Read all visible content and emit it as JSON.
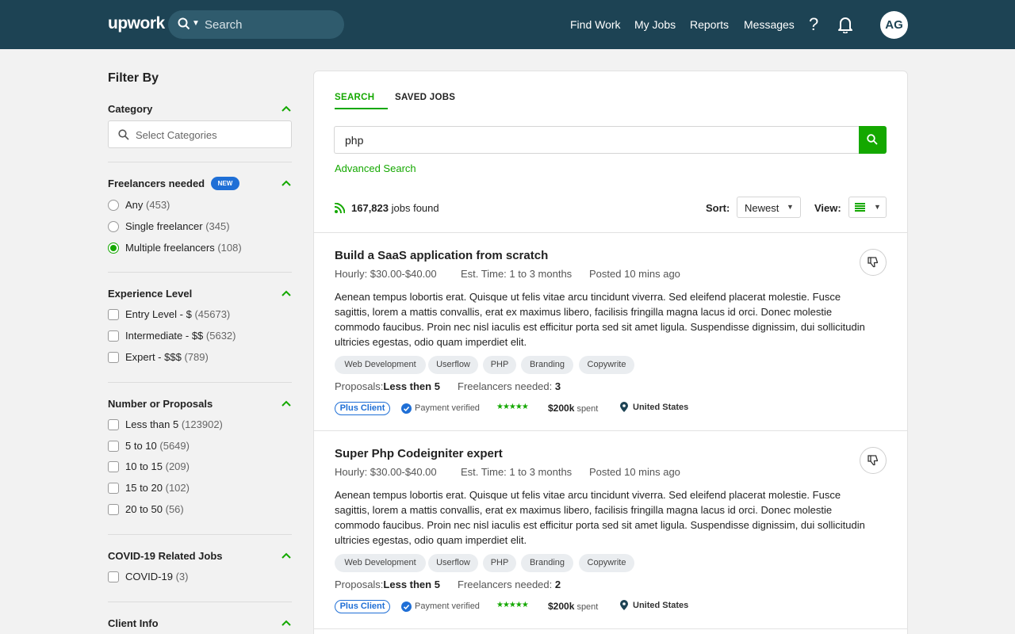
{
  "topnav": {
    "logo": "upwork",
    "search_placeholder": "Search",
    "links": [
      "Find Work",
      "My Jobs",
      "Reports",
      "Messages"
    ],
    "help_glyph": "?",
    "avatar_initials": "AG"
  },
  "sidebar": {
    "title": "Filter By",
    "category": {
      "title": "Category",
      "placeholder": "Select Categories"
    },
    "freelancers": {
      "title": "Freelancers needed",
      "badge": "NEW",
      "options": [
        {
          "label": "Any",
          "count": "(453)",
          "selected": false
        },
        {
          "label": "Single freelancer",
          "count": "(345)",
          "selected": false
        },
        {
          "label": "Multiple freelancers",
          "count": "(108)",
          "selected": true
        }
      ]
    },
    "experience": {
      "title": "Experience Level",
      "options": [
        {
          "label": "Entry Level - $",
          "count": "(45673)"
        },
        {
          "label": "Intermediate - $$",
          "count": "(5632)"
        },
        {
          "label": "Expert - $$$",
          "count": "(789)"
        }
      ]
    },
    "proposals": {
      "title": "Number or Proposals",
      "options": [
        {
          "label": "Less than 5",
          "count": "(123902)"
        },
        {
          "label": "5 to 10",
          "count": "(5649)"
        },
        {
          "label": "10 to 15",
          "count": "(209)"
        },
        {
          "label": "15 to 20",
          "count": "(102)"
        },
        {
          "label": "20 to 50",
          "count": "(56)"
        }
      ]
    },
    "covid": {
      "title": "COVID-19 Related Jobs",
      "options": [
        {
          "label": "COVID-19",
          "count": "(3)"
        }
      ]
    },
    "client_info": {
      "title": "Client Info"
    }
  },
  "main": {
    "tabs": [
      "SEARCH",
      "SAVED JOBS"
    ],
    "query": "php",
    "advanced_search": "Advanced Search",
    "jobs_count": "167,823",
    "jobs_found_suffix": "jobs found",
    "sort_label": "Sort:",
    "sort_value": "Newest",
    "view_label": "View:",
    "jobs": [
      {
        "title": "Build a SaaS application from scratch",
        "rate": "Hourly: $30.00-$40.00",
        "est_time": "Est. Time: 1 to 3 months",
        "posted": "Posted 10 mins ago",
        "description": "Aenean tempus lobortis erat. Quisque ut felis vitae arcu tincidunt viverra. Sed eleifend placerat molestie. Fusce sagittis, lorem a mattis convallis, erat ex maximus libero, facilisis fringilla magna lacus id orci. Donec molestie commodo faucibus. Proin nec nisl iaculis est efficitur porta sed sit amet ligula. Suspendisse dignissim, dui sollicitudin ultricies egestas, odio quam imperdiet elit.",
        "skills": [
          "Web Development",
          "Userflow",
          "PHP",
          "Branding",
          "Copywrite"
        ],
        "proposals_label": "Proposals:",
        "proposals_value": "Less then 5",
        "freelancers_label": "Freelancers needed:",
        "freelancers_value": "3",
        "plus_client": "Plus Client",
        "payment": "Payment verified",
        "stars": "★★★★★",
        "spent_amount": "$200k",
        "spent_label": "spent",
        "location": "United States"
      },
      {
        "title": "Super Php Codeigniter expert",
        "rate": "Hourly: $30.00-$40.00",
        "est_time": "Est. Time: 1 to 3 months",
        "posted": "Posted 10 mins ago",
        "description": "Aenean tempus lobortis erat. Quisque ut felis vitae arcu tincidunt viverra. Sed eleifend placerat molestie. Fusce sagittis, lorem a mattis convallis, erat ex maximus libero, facilisis fringilla magna lacus id orci. Donec molestie commodo faucibus. Proin nec nisl iaculis est efficitur porta sed sit amet ligula. Suspendisse dignissim, dui sollicitudin ultricies egestas, odio quam imperdiet elit.",
        "skills": [
          "Web Development",
          "Userflow",
          "PHP",
          "Branding",
          "Copywrite"
        ],
        "proposals_label": "Proposals:",
        "proposals_value": "Less then 5",
        "freelancers_label": "Freelancers needed:",
        "freelancers_value": "2",
        "plus_client": "Plus Client",
        "payment": "Payment verified",
        "stars": "★★★★★",
        "spent_amount": "$200k",
        "spent_label": "spent",
        "location": "United States"
      }
    ]
  },
  "colors": {
    "nav_bg": "#1d4354",
    "accent_green": "#14a800",
    "badge_blue": "#1f6fd6"
  },
  "icons": [
    "search-icon",
    "chevron-down-icon",
    "help-icon",
    "bell-icon",
    "chevron-up-icon",
    "rss-icon",
    "list-view-icon",
    "thumbs-down-icon",
    "verified-icon",
    "location-pin-icon"
  ]
}
